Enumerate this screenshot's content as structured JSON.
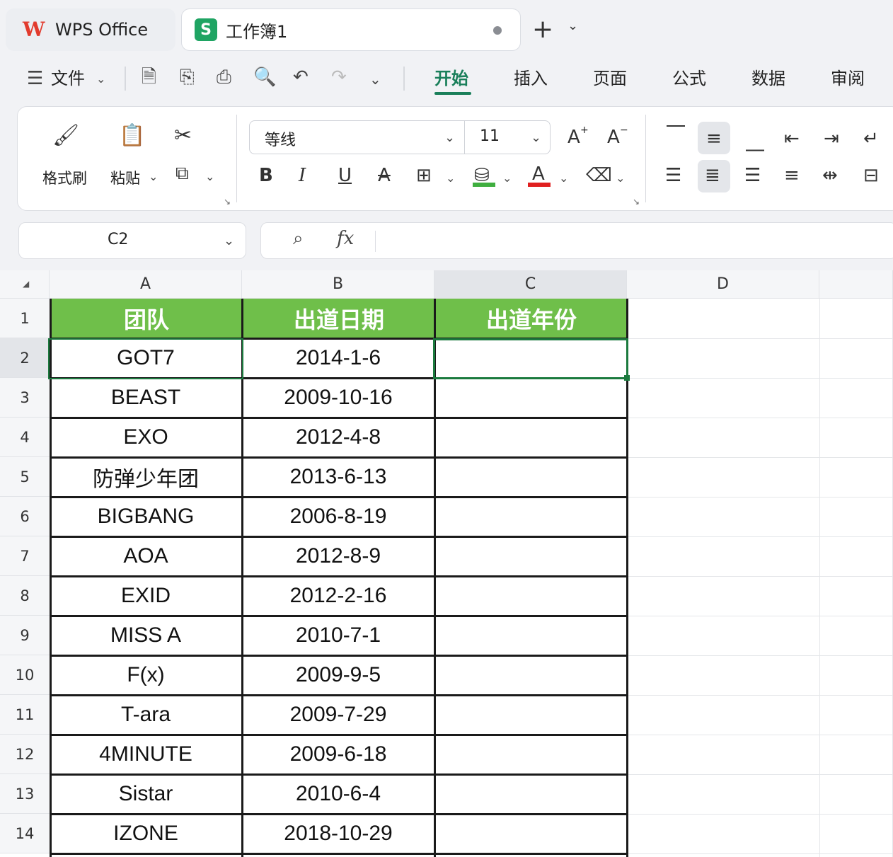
{
  "tabs": {
    "app_name": "WPS Office",
    "app_logo": "W",
    "doc_name": "工作簿1",
    "doc_logo": "S",
    "new_tab": "+",
    "tab_menu": "⌄"
  },
  "menu": {
    "file_label": "文件",
    "items": [
      "开始",
      "插入",
      "页面",
      "公式",
      "数据",
      "审阅"
    ],
    "active": "开始"
  },
  "ribbon": {
    "format_painter": "格式刷",
    "paste": "粘贴",
    "font_name": "等线",
    "font_size": "11",
    "bold": "B",
    "italic": "I",
    "underline": "U",
    "strike": "A",
    "grow_font": "A",
    "shrink_font": "A",
    "font_color": "A"
  },
  "formula_bar": {
    "cell_ref": "C2",
    "fx_label": "fx",
    "content": ""
  },
  "sheet": {
    "columns": [
      "A",
      "B",
      "C",
      "D"
    ],
    "selected_column": "C",
    "rows": [
      "1",
      "2",
      "3",
      "4",
      "5",
      "6",
      "7",
      "8",
      "9",
      "10",
      "11",
      "12",
      "13",
      "14"
    ],
    "selected_row": "2",
    "header": [
      "团队",
      "出道日期",
      "出道年份"
    ],
    "data": [
      [
        "GOT7",
        "2014-1-6",
        ""
      ],
      [
        "BEAST",
        "2009-10-16",
        ""
      ],
      [
        "EXO",
        "2012-4-8",
        ""
      ],
      [
        "防弹少年团",
        "2013-6-13",
        ""
      ],
      [
        "BIGBANG",
        "2006-8-19",
        ""
      ],
      [
        "AOA",
        "2012-8-9",
        ""
      ],
      [
        "EXID",
        "2012-2-16",
        ""
      ],
      [
        "MISS A",
        "2010-7-1",
        ""
      ],
      [
        "F(x)",
        "2009-9-5",
        ""
      ],
      [
        "T-ara",
        "2009-7-29",
        ""
      ],
      [
        "4MINUTE",
        "2009-6-18",
        ""
      ],
      [
        "Sistar",
        "2010-6-4",
        ""
      ],
      [
        "IZONE",
        "2018-10-29",
        ""
      ]
    ],
    "header_color": "#6fbf4a",
    "selection_color": "#1b7a3e"
  }
}
